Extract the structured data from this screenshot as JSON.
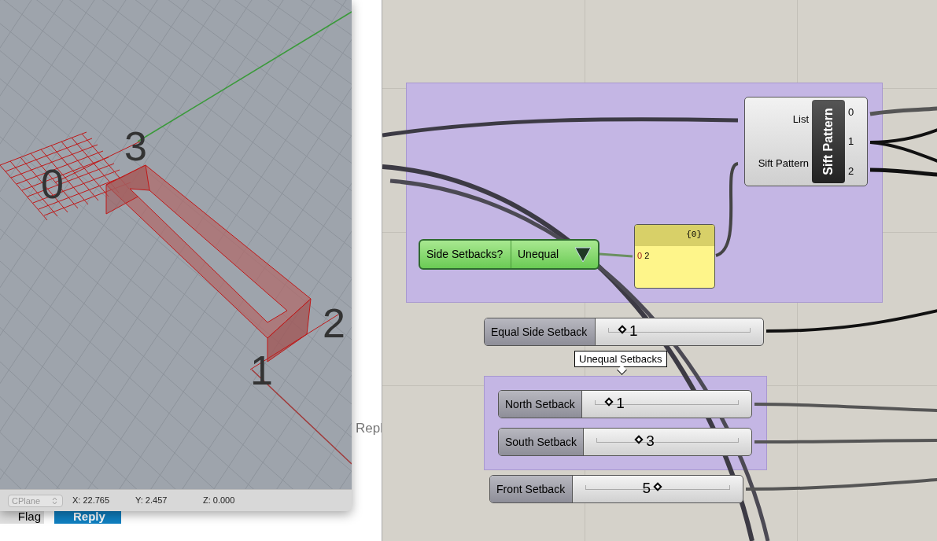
{
  "viewport": {
    "point_labels": [
      {
        "text": "0",
        "kind": "p0"
      },
      {
        "text": "3",
        "kind": "p3"
      },
      {
        "text": "2",
        "kind": "p2"
      },
      {
        "text": "1",
        "kind": "p1"
      }
    ]
  },
  "status_bar": {
    "cplane": "CPlane",
    "x": "X: 22.765",
    "y": "Y: 2.457",
    "z": "Z: 0.000"
  },
  "background_page": {
    "reply_link": "Repl",
    "flag_button": "Flag",
    "reply_button": "Reply"
  },
  "sift": {
    "title": "Sift Pattern",
    "inputs": [
      "List",
      "Sift Pattern"
    ],
    "outputs": [
      "0",
      "1",
      "2"
    ]
  },
  "value_list": {
    "label": "Side Setbacks?",
    "value": "Unequal"
  },
  "panel": {
    "header": "{0}",
    "index": "0",
    "value": "2"
  },
  "group_label": "Unequal Setbacks",
  "sliders": [
    {
      "label": "Equal Side Setback",
      "value": "1",
      "level": 0.1,
      "kind": "value_after"
    },
    {
      "label": "North Setback",
      "value": "1",
      "level": 0.1,
      "kind": "value_after"
    },
    {
      "label": "South Setback",
      "value": "3",
      "level": 0.3,
      "kind": "value_after"
    },
    {
      "label": "Front Setback",
      "value": "5",
      "level": 0.5,
      "kind": "value_before"
    }
  ]
}
